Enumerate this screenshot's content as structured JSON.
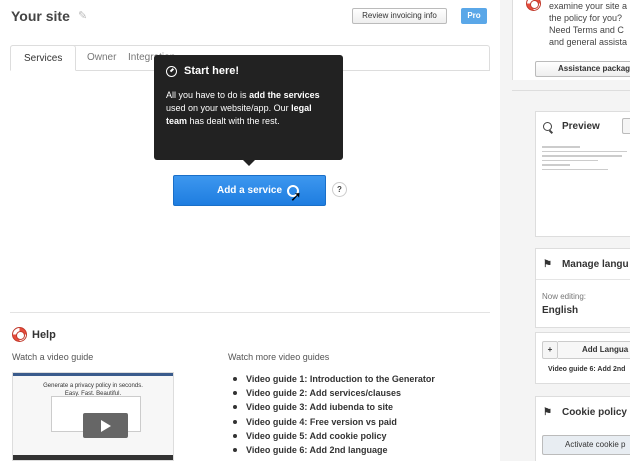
{
  "header": {
    "site_title": "Your site",
    "invoicing_button": "Review invoicing info",
    "plan_badge": "Pro"
  },
  "tabs": [
    {
      "label": "Services",
      "active": true
    },
    {
      "label": "Owner",
      "active": false
    },
    {
      "label": "Integration",
      "active": false
    }
  ],
  "tooltip": {
    "title": "Start here!",
    "text_1": "All you have to do is ",
    "text_2": "add the services",
    "text_3": " used on your website/app. Our ",
    "text_4": "legal team",
    "text_5": " has dealt with the rest."
  },
  "main": {
    "add_service_button": "Add a service",
    "help_icon": "?"
  },
  "help": {
    "title": "Help",
    "watch_label": "Watch a video guide",
    "more_label": "Watch more video guides",
    "video_title": "Generate a privacy policy in seconds.\nEasy. Fast. Beautiful.",
    "guides": [
      "Video guide 1: Introduction to the Generator",
      "Video guide 2: Add services/clauses",
      "Video guide 3: Add iubenda to site",
      "Video guide 4: Free version vs paid",
      "Video guide 5: Add cookie policy",
      "Video guide 6: Add 2nd language"
    ]
  },
  "sidebar": {
    "intro_lines": [
      "examine your site a",
      "the policy for you?",
      "Need Terms and C",
      "and general assista"
    ],
    "assistance_button": "Assistance packag",
    "preview_title": "Preview",
    "languages_title": "Manage langu",
    "now_editing_label": "Now editing:",
    "current_language": "English",
    "plus_label": "+",
    "add_language_button": "Add Langua",
    "language_guide_note": "Video guide 6: Add 2nd",
    "cookie_title": "Cookie policy",
    "cookie_button": "Activate cookie p"
  },
  "colors": {
    "accent_blue": "#1e7de0",
    "pro_badge": "#5aa7e8",
    "tooltip_bg": "#222222"
  }
}
